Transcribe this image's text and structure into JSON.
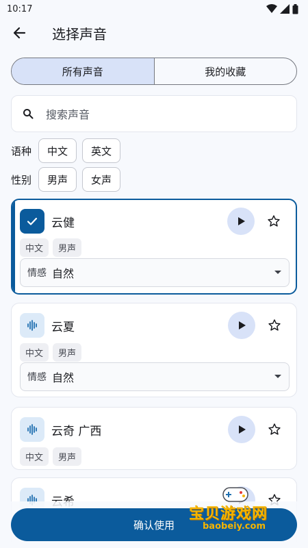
{
  "status": {
    "time": "10:17"
  },
  "header": {
    "title": "选择声音"
  },
  "tabs": [
    {
      "label": "所有声音",
      "active": true
    },
    {
      "label": "我的收藏",
      "active": false
    }
  ],
  "search": {
    "placeholder": "搜索声音"
  },
  "filters": {
    "language": {
      "label": "语种",
      "options": [
        "中文",
        "英文"
      ]
    },
    "gender": {
      "label": "性别",
      "options": [
        "男声",
        "女声"
      ]
    }
  },
  "voices": [
    {
      "name": "云健",
      "tags": [
        "中文",
        "男声"
      ],
      "emotion_label": "情感",
      "emotion_value": "自然",
      "selected": true
    },
    {
      "name": "云夏",
      "tags": [
        "中文",
        "男声"
      ],
      "emotion_label": "情感",
      "emotion_value": "自然",
      "selected": false
    },
    {
      "name": "云奇 广西",
      "tags": [
        "中文",
        "男声"
      ],
      "selected": false
    },
    {
      "name": "云希",
      "selected": false
    }
  ],
  "confirm": {
    "label": "确认使用"
  },
  "watermark": {
    "text": "宝贝游戏网",
    "url": "baobeiy.com"
  },
  "colors": {
    "primary": "#0b5b9c",
    "tonal": "#d8e2f8",
    "background": "#f7f9fd"
  }
}
